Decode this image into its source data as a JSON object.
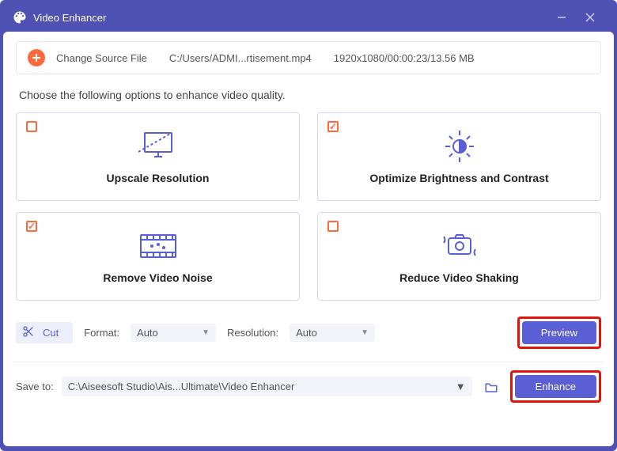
{
  "window": {
    "title": "Video Enhancer"
  },
  "source": {
    "change_label": "Change Source File",
    "path": "C:/Users/ADMI...rtisement.mp4",
    "info": "1920x1080/00:00:23/13.56 MB"
  },
  "instruction": "Choose the following options to enhance video quality.",
  "options": {
    "upscale": {
      "label": "Upscale Resolution",
      "checked": false
    },
    "brightness": {
      "label": "Optimize Brightness and Contrast",
      "checked": true
    },
    "noise": {
      "label": "Remove Video Noise",
      "checked": true
    },
    "shaking": {
      "label": "Reduce Video Shaking",
      "checked": false
    }
  },
  "controls": {
    "cut_label": "Cut",
    "format_label": "Format:",
    "format_value": "Auto",
    "resolution_label": "Resolution:",
    "resolution_value": "Auto",
    "preview_label": "Preview"
  },
  "save": {
    "label": "Save to:",
    "path": "C:\\Aiseesoft Studio\\Ais...Ultimate\\Video Enhancer",
    "enhance_label": "Enhance"
  }
}
